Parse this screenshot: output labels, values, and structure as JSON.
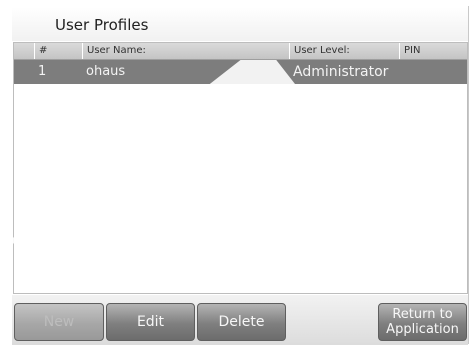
{
  "header": {
    "title": "User Profiles"
  },
  "table": {
    "columns": [
      "#",
      "User Name:",
      "User Level:",
      "PIN"
    ],
    "rows": [
      {
        "index": "1",
        "name": "ohaus",
        "level": "Administrator",
        "pin": ""
      }
    ]
  },
  "buttons": {
    "new": "New",
    "edit": "Edit",
    "delete": "Delete",
    "return_line1": "Return to",
    "return_line2": "Application"
  },
  "colors": {
    "selected_row": "#7d7d7d",
    "button": "#7f7f7f"
  }
}
